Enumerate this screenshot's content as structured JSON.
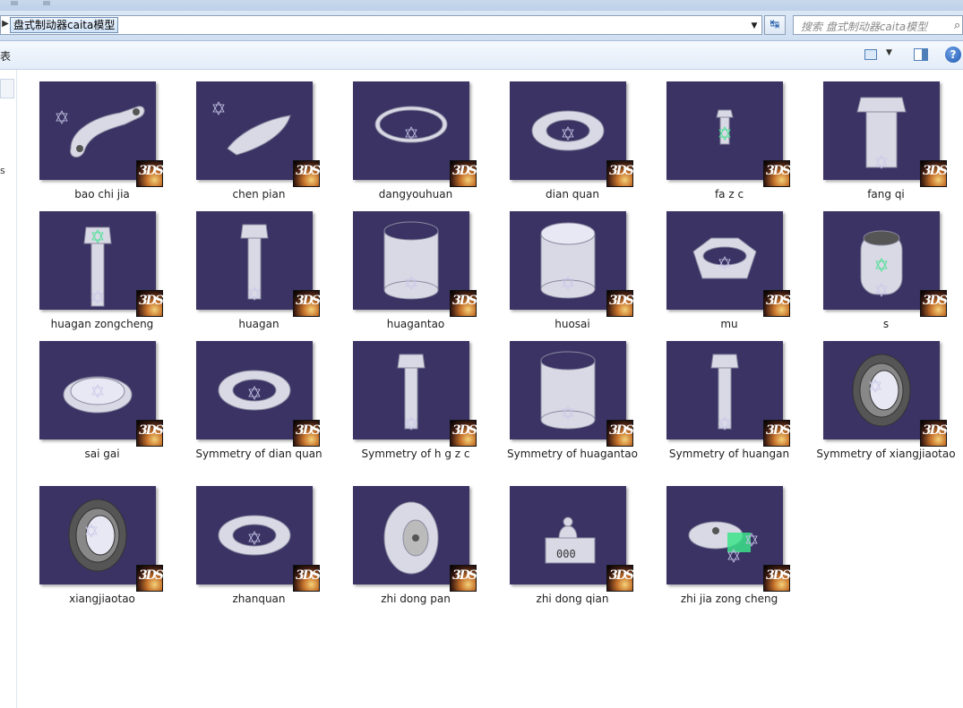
{
  "address": {
    "path": "盘式制动器caita模型",
    "search_placeholder": "搜索 盘式制动器caita模型"
  },
  "toolbar": {
    "cut_text": "表",
    "help": "?"
  },
  "navpane": {
    "partial_text": "s"
  },
  "badge_text": "3DS",
  "files": [
    {
      "name": "bao chi jia",
      "shape": "bracket"
    },
    {
      "name": "chen pian",
      "shape": "pad"
    },
    {
      "name": "dangyouhuan",
      "shape": "flatring"
    },
    {
      "name": "dian quan",
      "shape": "washer"
    },
    {
      "name": "fa z c",
      "shape": "smallbolt"
    },
    {
      "name": "fang qi",
      "shape": "bigplug"
    },
    {
      "name": "huagan zongcheng",
      "shape": "boltasm"
    },
    {
      "name": "huagan",
      "shape": "bolt"
    },
    {
      "name": "huagantao",
      "shape": "sleeve"
    },
    {
      "name": "huosai",
      "shape": "piston"
    },
    {
      "name": "mu",
      "shape": "nut"
    },
    {
      "name": "s",
      "shape": "barrel"
    },
    {
      "name": "sai gai",
      "shape": "cap"
    },
    {
      "name": "Symmetry of dian quan",
      "shape": "washer"
    },
    {
      "name": "Symmetry of h g z c",
      "shape": "bolt"
    },
    {
      "name": "Symmetry of huagantao",
      "shape": "sleeve"
    },
    {
      "name": "Symmetry of huangan",
      "shape": "bolt"
    },
    {
      "name": "Symmetry of xiangjiaotao",
      "shape": "rubber"
    },
    {
      "name": "xiangjiaotao",
      "shape": "rubber"
    },
    {
      "name": "zhanquan",
      "shape": "washer"
    },
    {
      "name": "zhi dong pan",
      "shape": "disc"
    },
    {
      "name": "zhi dong qian",
      "shape": "caliper"
    },
    {
      "name": "zhi jia zong cheng",
      "shape": "assembly"
    }
  ]
}
